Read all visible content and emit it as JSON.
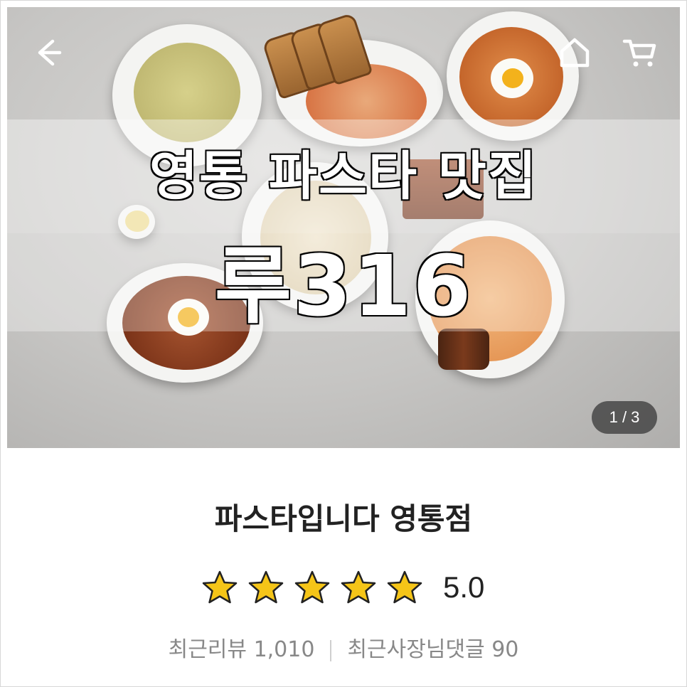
{
  "hero": {
    "overlay_line1": "영통 파스타 맛집",
    "overlay_line2": "루316",
    "image_counter": "1 / 3",
    "icons": {
      "back": "arrow-left-icon",
      "home": "home-icon",
      "cart": "cart-icon"
    }
  },
  "store": {
    "name": "파스타입니다 영통점",
    "rating": {
      "stars_filled": 5,
      "stars_total": 5,
      "value": "5.0"
    },
    "stats": {
      "recent_reviews_label": "최근리뷰",
      "recent_reviews_count": "1,010",
      "owner_replies_label": "최근사장님댓글",
      "owner_replies_count": "90"
    }
  },
  "colors": {
    "star_fill": "#f5c518",
    "star_outline": "#222222",
    "text_primary": "#222222",
    "text_secondary": "#888888"
  }
}
